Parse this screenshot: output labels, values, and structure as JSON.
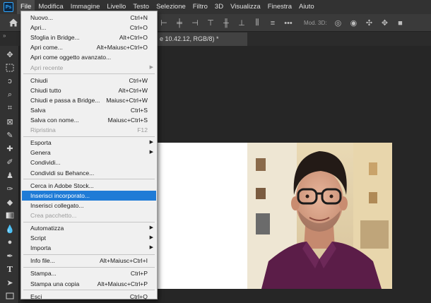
{
  "app_logo": "Ps",
  "menubar": [
    "File",
    "Modifica",
    "Immagine",
    "Livello",
    "Testo",
    "Selezione",
    "Filtro",
    "3D",
    "Visualizza",
    "Finestra",
    "Aiuto"
  ],
  "options_bar": {
    "mod3d_label": "Mod. 3D:"
  },
  "strip": {
    "collapse": "»"
  },
  "document_tab": "e 10.42.12, RGB/8) *",
  "file_menu": {
    "groups": [
      [
        {
          "label": "Nuovo...",
          "shortcut": "Ctrl+N"
        },
        {
          "label": "Apri...",
          "shortcut": "Ctrl+O"
        },
        {
          "label": "Sfoglia in Bridge...",
          "shortcut": "Alt+Ctrl+O"
        },
        {
          "label": "Apri come...",
          "shortcut": "Alt+Maiusc+Ctrl+O"
        },
        {
          "label": "Apri come oggetto avanzato...",
          "shortcut": ""
        },
        {
          "label": "Apri recente",
          "shortcut": "",
          "submenu": true,
          "disabled": true
        }
      ],
      [
        {
          "label": "Chiudi",
          "shortcut": "Ctrl+W"
        },
        {
          "label": "Chiudi tutto",
          "shortcut": "Alt+Ctrl+W"
        },
        {
          "label": "Chiudi e passa a Bridge...",
          "shortcut": "Maiusc+Ctrl+W"
        },
        {
          "label": "Salva",
          "shortcut": "Ctrl+S"
        },
        {
          "label": "Salva con nome...",
          "shortcut": "Maiusc+Ctrl+S"
        },
        {
          "label": "Ripristina",
          "shortcut": "F12",
          "disabled": true
        }
      ],
      [
        {
          "label": "Esporta",
          "shortcut": "",
          "submenu": true
        },
        {
          "label": "Genera",
          "shortcut": "",
          "submenu": true
        },
        {
          "label": "Condividi...",
          "shortcut": ""
        },
        {
          "label": "Condividi su Behance...",
          "shortcut": ""
        }
      ],
      [
        {
          "label": "Cerca in Adobe Stock...",
          "shortcut": ""
        },
        {
          "label": "Inserisci incorporato...",
          "shortcut": "",
          "highlighted": true
        },
        {
          "label": "Inserisci collegato...",
          "shortcut": ""
        },
        {
          "label": "Crea pacchetto...",
          "shortcut": "",
          "disabled": true
        }
      ],
      [
        {
          "label": "Automatizza",
          "shortcut": "",
          "submenu": true
        },
        {
          "label": "Script",
          "shortcut": "",
          "submenu": true
        },
        {
          "label": "Importa",
          "shortcut": "",
          "submenu": true
        }
      ],
      [
        {
          "label": "Info file...",
          "shortcut": "Alt+Maiusc+Ctrl+I"
        }
      ],
      [
        {
          "label": "Stampa...",
          "shortcut": "Ctrl+P"
        },
        {
          "label": "Stampa una copia",
          "shortcut": "Alt+Maiusc+Ctrl+P"
        }
      ],
      [
        {
          "label": "Esci",
          "shortcut": "Ctrl+Q"
        }
      ]
    ]
  },
  "tools": [
    "move-tool",
    "marquee-tool",
    "lasso-tool",
    "quick-select-tool",
    "crop-tool",
    "frame-tool",
    "eyedropper-tool",
    "healing-tool",
    "brush-tool",
    "stamp-tool",
    "history-brush-tool",
    "eraser-tool",
    "gradient-tool",
    "blur-tool",
    "dodge-tool",
    "pen-tool",
    "type-tool",
    "path-select-tool",
    "shape-tool"
  ],
  "colors": {
    "highlight": "#1f7bd6",
    "menu_bg": "#f0f0f0",
    "app_bg": "#262626",
    "ps_blue": "#31a8ff"
  }
}
